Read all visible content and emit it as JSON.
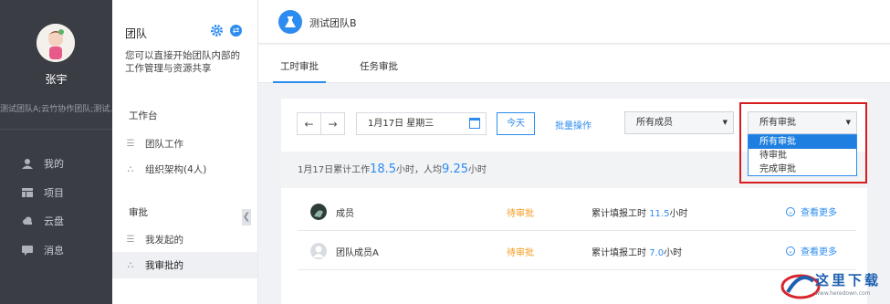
{
  "user": {
    "name": "张宇",
    "teams": "测试团队A;云竹协作团队;测试..."
  },
  "nav": [
    {
      "label": "我的",
      "icon": "user-icon"
    },
    {
      "label": "项目",
      "icon": "project-icon"
    },
    {
      "label": "云盘",
      "icon": "cloud-icon"
    },
    {
      "label": "消息",
      "icon": "message-icon"
    }
  ],
  "sidebar": {
    "title": "团队",
    "description": "您可以直接开始团队内部的工作管理与资源共享",
    "workbench_heading": "工作台",
    "workbench_items": [
      "团队工作",
      "组织架构(4人)"
    ],
    "approval_heading": "审批",
    "approval_items": [
      "我发起的",
      "我审批的"
    ]
  },
  "header": {
    "team_name": "测试团队B"
  },
  "tabs": [
    "工时审批",
    "任务审批"
  ],
  "toolbar": {
    "prev": "←",
    "next": "→",
    "date": "1月17日  星期三",
    "today": "今天",
    "batch": "批量操作",
    "member_select": "所有成员",
    "approval_select": "所有审批"
  },
  "summary": {
    "prefix": "1月17日累计工作",
    "total": "18.5",
    "mid": "小时，人均",
    "avg": "9.25",
    "suffix": "小时"
  },
  "rows": [
    {
      "name": "成员",
      "status": "待审批",
      "hours_label": "累计填报工时",
      "hours": "11.5",
      "unit": "小时",
      "more": "查看更多"
    },
    {
      "name": "团队成员A",
      "status": "待审批",
      "hours_label": "累计填报工时",
      "hours": "7.0",
      "unit": "小时",
      "more": "查看更多"
    }
  ],
  "dropdown_options": [
    "所有审批",
    "待审批",
    "完成审批"
  ],
  "watermark": {
    "text": "这里下载",
    "url": "www.heredown.com"
  },
  "colors": {
    "accent": "#2d8cf0",
    "pending": "#f29a1a",
    "highlight": "#d71c1c",
    "nav_bg": "#3a3d44"
  }
}
